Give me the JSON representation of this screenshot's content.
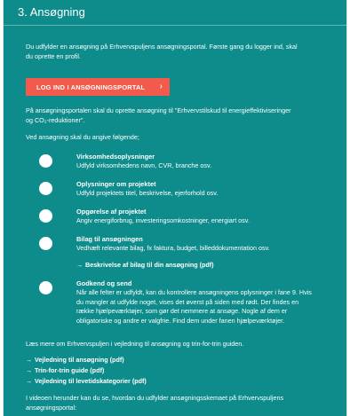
{
  "section": {
    "title": "3. Ansøgning"
  },
  "intro": {
    "line1": "Du udfylder en ansøgning på Erhvervspuljens ansøgningsportal. Første gang du logger ind, skal",
    "line2": "du oprette en profil."
  },
  "login_button": {
    "label": "LOG IND I ANSØGNINGSPORTAL",
    "chevron": "›"
  },
  "portal_text": {
    "line1": "På ansøgningsportalen skal du oprette ansøgning til \"Erhvervstilskud til energieffektiviseringer",
    "line2": "og CO₂-reduktioner\"."
  },
  "provide_text": "Ved ansøgning skal du angive følgende;",
  "items": [
    {
      "title": "Virksomhedsoplysninger",
      "lines": [
        "Udfyld virksomhedens navn, CVR, branche osv."
      ]
    },
    {
      "title": "Oplysninger om projektet",
      "lines": [
        "Udfyld projektets titel, beskrivelse, ejerforhold osv."
      ]
    },
    {
      "title": "Opgørelse af projektet",
      "lines": [
        "Angiv energiforbrug, investeringsomkostninger, energiart osv."
      ]
    },
    {
      "title": "Bilag til ansøgningen",
      "lines": [
        "Vedhæft relevante bilag, fx faktura, budget, billeddokumentation osv."
      ],
      "link": "Beskrivelse af bilag til din ansøgning (pdf)"
    },
    {
      "title": "Godkend og send",
      "lines": [
        "Når alle felter er udfyldt, kan du kontrollere ansøgningens oplysninger i fane 9. Hvis",
        "du mangler at udfylde noget, vises det øverst på siden med rødt. Der findes en",
        "række hjælpeværktøjer, som gør det nemmere at ansøge. Nogle af dem er",
        "obligatoriske og andre er valgfrie. Find dem under fanen hjælpeværktøjer."
      ]
    }
  ],
  "read_more": "Læs mere om Erhvervspuljen i vejledning til ansøgning og trin-for-trin guiden.",
  "links": [
    "Vejledning til ansøgning (pdf)",
    "Trin-for-trin guide (pdf)",
    "Vejledning til levetidskategorier (pdf)"
  ],
  "video_text": {
    "line1": "I videoen herunder kan du se, hvordan du udfylder ansøgningsskemaet på Erhvervspuljens",
    "line2": "ansøgningsportal:"
  },
  "arrow_glyph": "→",
  "colors": {
    "panel_bg": "#0e8b8b",
    "button_bg": "#f35a4b",
    "text": "#ffffff"
  }
}
